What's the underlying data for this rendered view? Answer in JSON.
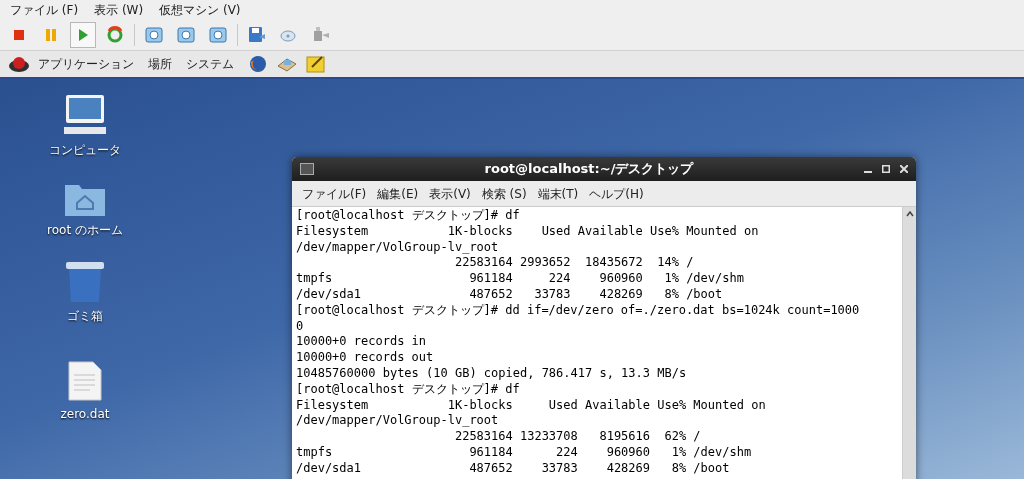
{
  "vm_menu": [
    "ファイル (F)",
    "表示 (W)",
    "仮想マシン (V)"
  ],
  "vm_toolbar": [
    {
      "kind": "stop",
      "pressed": false
    },
    {
      "kind": "pause",
      "pressed": false
    },
    {
      "kind": "play",
      "pressed": true
    },
    {
      "kind": "reset",
      "pressed": false
    },
    {
      "kind": "sep"
    },
    {
      "kind": "snapshot",
      "pressed": false
    },
    {
      "kind": "restore",
      "pressed": false
    },
    {
      "kind": "manage",
      "pressed": false
    },
    {
      "kind": "sep"
    },
    {
      "kind": "save",
      "pressed": false
    },
    {
      "kind": "disc",
      "pressed": false
    },
    {
      "kind": "usb",
      "pressed": false
    }
  ],
  "panel": {
    "menus": [
      "アプリケーション",
      "場所",
      "システム"
    ],
    "launchers": [
      {
        "kind": "browser"
      },
      {
        "kind": "mail"
      },
      {
        "kind": "notes"
      }
    ]
  },
  "desktop_icons": [
    {
      "kind": "computer",
      "label": "コンピュータ"
    },
    {
      "kind": "home",
      "label": "root のホーム"
    },
    {
      "kind": "trash",
      "label": "ゴミ箱"
    },
    {
      "kind": "file",
      "label": "zero.dat"
    }
  ],
  "terminal": {
    "title": "root@localhost:~/デスクトップ",
    "menu": [
      "ファイル(F)",
      "編集(E)",
      "表示(V)",
      "検索 (S)",
      "端末(T)",
      "ヘルプ(H)"
    ],
    "lines": [
      "[root@localhost デスクトップ]# df",
      "Filesystem           1K-blocks    Used Available Use% Mounted on",
      "/dev/mapper/VolGroup-lv_root",
      "                      22583164 2993652  18435672  14% /",
      "tmpfs                   961184     224    960960   1% /dev/shm",
      "/dev/sda1               487652   33783    428269   8% /boot",
      "[root@localhost デスクトップ]# dd if=/dev/zero of=./zero.dat bs=1024k count=1000",
      "0",
      "10000+0 records in",
      "10000+0 records out",
      "10485760000 bytes (10 GB) copied, 786.417 s, 13.3 MB/s",
      "[root@localhost デスクトップ]# df",
      "Filesystem           1K-blocks     Used Available Use% Mounted on",
      "/dev/mapper/VolGroup-lv_root",
      "                      22583164 13233708   8195616  62% /",
      "tmpfs                   961184      224    960960   1% /dev/shm",
      "/dev/sda1               487652    33783    428269   8% /boot"
    ]
  }
}
